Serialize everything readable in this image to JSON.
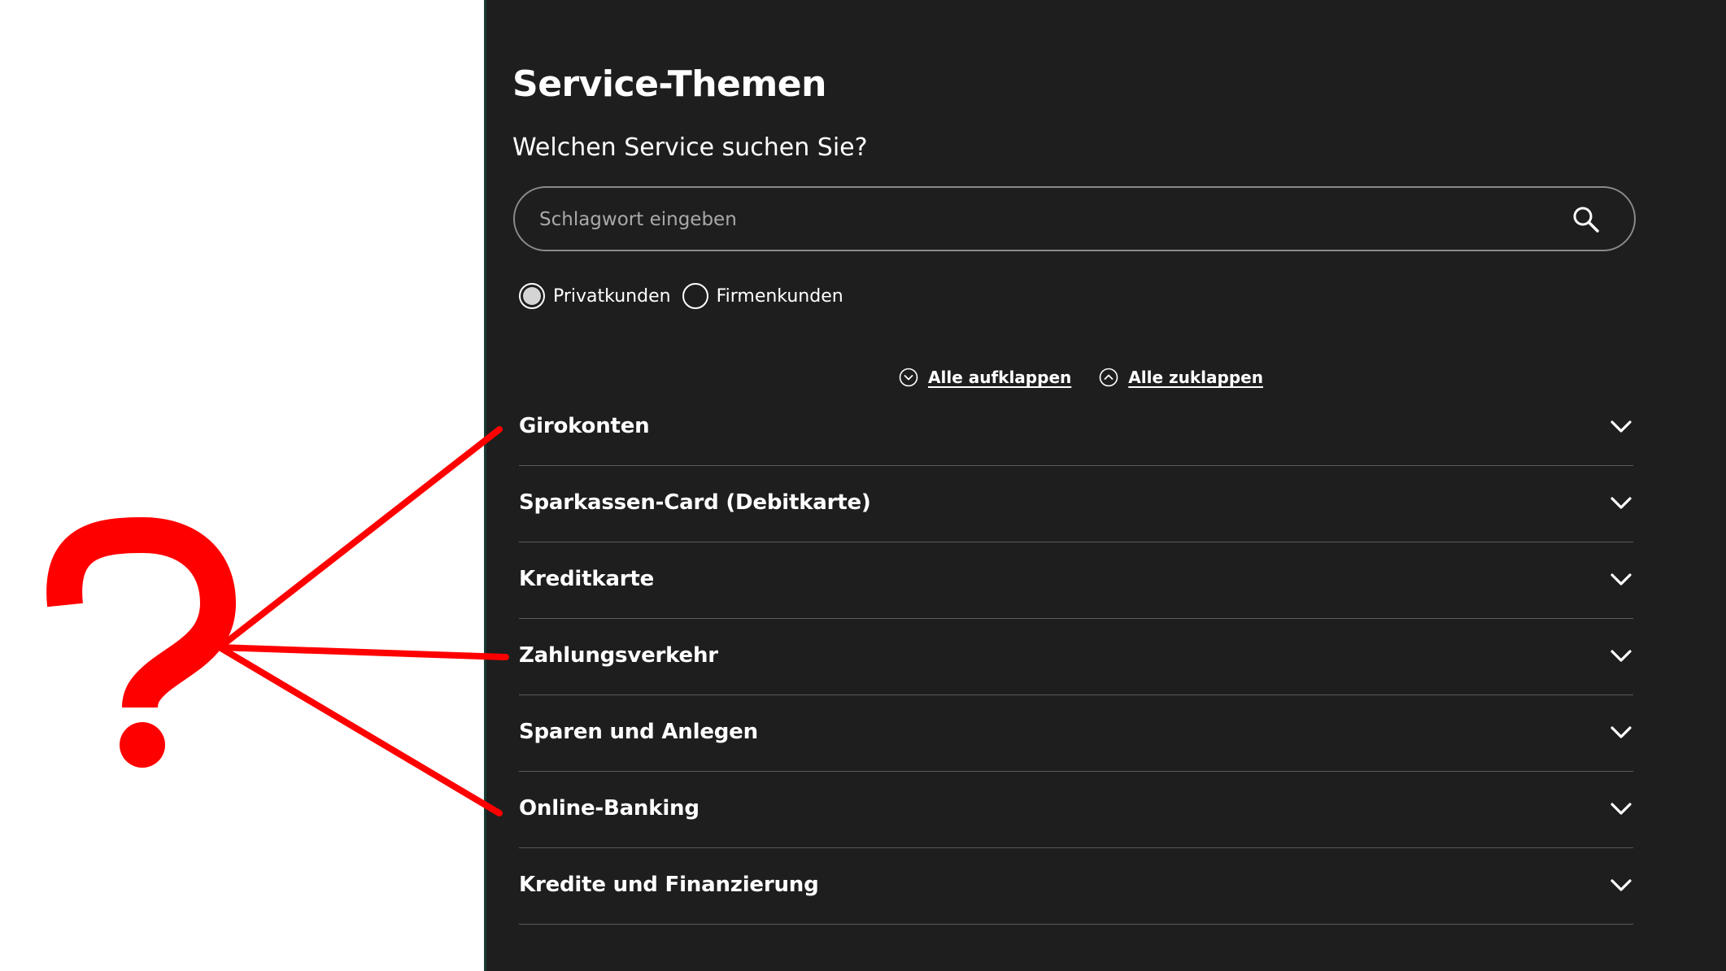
{
  "header": {
    "title": "Service-Themen",
    "subtitle": "Welchen Service suchen Sie?"
  },
  "search": {
    "placeholder": "Schlagwort eingeben",
    "value": "",
    "icon": "search-icon"
  },
  "customer_type": {
    "options": [
      {
        "label": "Privatkunden",
        "selected": true
      },
      {
        "label": "Firmenkunden",
        "selected": false
      }
    ]
  },
  "toggles": {
    "expand_all": "Alle aufklappen",
    "collapse_all": "Alle zuklappen"
  },
  "topics": [
    {
      "label": "Girokonten"
    },
    {
      "label": "Sparkassen-Card (Debitkarte)"
    },
    {
      "label": "Kreditkarte"
    },
    {
      "label": "Zahlungsverkehr"
    },
    {
      "label": "Sparen und Anlegen"
    },
    {
      "label": "Online-Banking"
    },
    {
      "label": "Kredite und Finanzierung"
    }
  ],
  "annotation": {
    "symbol": "question-mark",
    "color": "#ff0000"
  },
  "colors": {
    "panel_background": "#1e1e1e",
    "text": "#ffffff",
    "divider": "#5a5a5a",
    "annotation": "#ff0000"
  }
}
